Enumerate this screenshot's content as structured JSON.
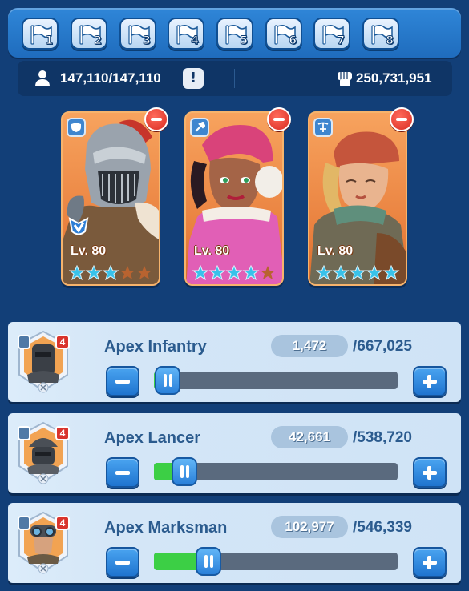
{
  "flags": [
    {
      "number": "1"
    },
    {
      "number": "2"
    },
    {
      "number": "3"
    },
    {
      "number": "4"
    },
    {
      "number": "5"
    },
    {
      "number": "6"
    },
    {
      "number": "7"
    },
    {
      "number": "8"
    }
  ],
  "stats": {
    "troop_capacity": "147,110/147,110",
    "alert_symbol": "!",
    "power": "250,731,951",
    "capacity_icon": "person-icon",
    "power_icon": "fist-icon"
  },
  "heroes": [
    {
      "level": "Lv. 80",
      "role_icon": "shield-icon",
      "stars_filled": 3,
      "stars_total": 5
    },
    {
      "level": "Lv. 80",
      "role_icon": "lance-icon",
      "stars_filled": 4,
      "stars_total": 5
    },
    {
      "level": "Lv. 80",
      "role_icon": "crossbow-icon",
      "stars_filled": 5,
      "stars_total": 5
    }
  ],
  "troops": [
    {
      "name": "Apex Infantry",
      "count": "1,472",
      "max": "/667,025",
      "tier": "4",
      "fill_fraction": 0.002
    },
    {
      "name": "Apex Lancer",
      "count": "42,661",
      "max": "/538,720",
      "tier": "4",
      "fill_fraction": 0.08
    },
    {
      "name": "Apex Marksman",
      "count": "102,977",
      "max": "/546,339",
      "tier": "4",
      "fill_fraction": 0.19
    }
  ],
  "colors": {
    "background": "#123f78",
    "card_orange": "#e9803e",
    "slider_fill": "#3ccf45",
    "remove_red": "#d92c22",
    "button_blue": "#1f74cf"
  }
}
